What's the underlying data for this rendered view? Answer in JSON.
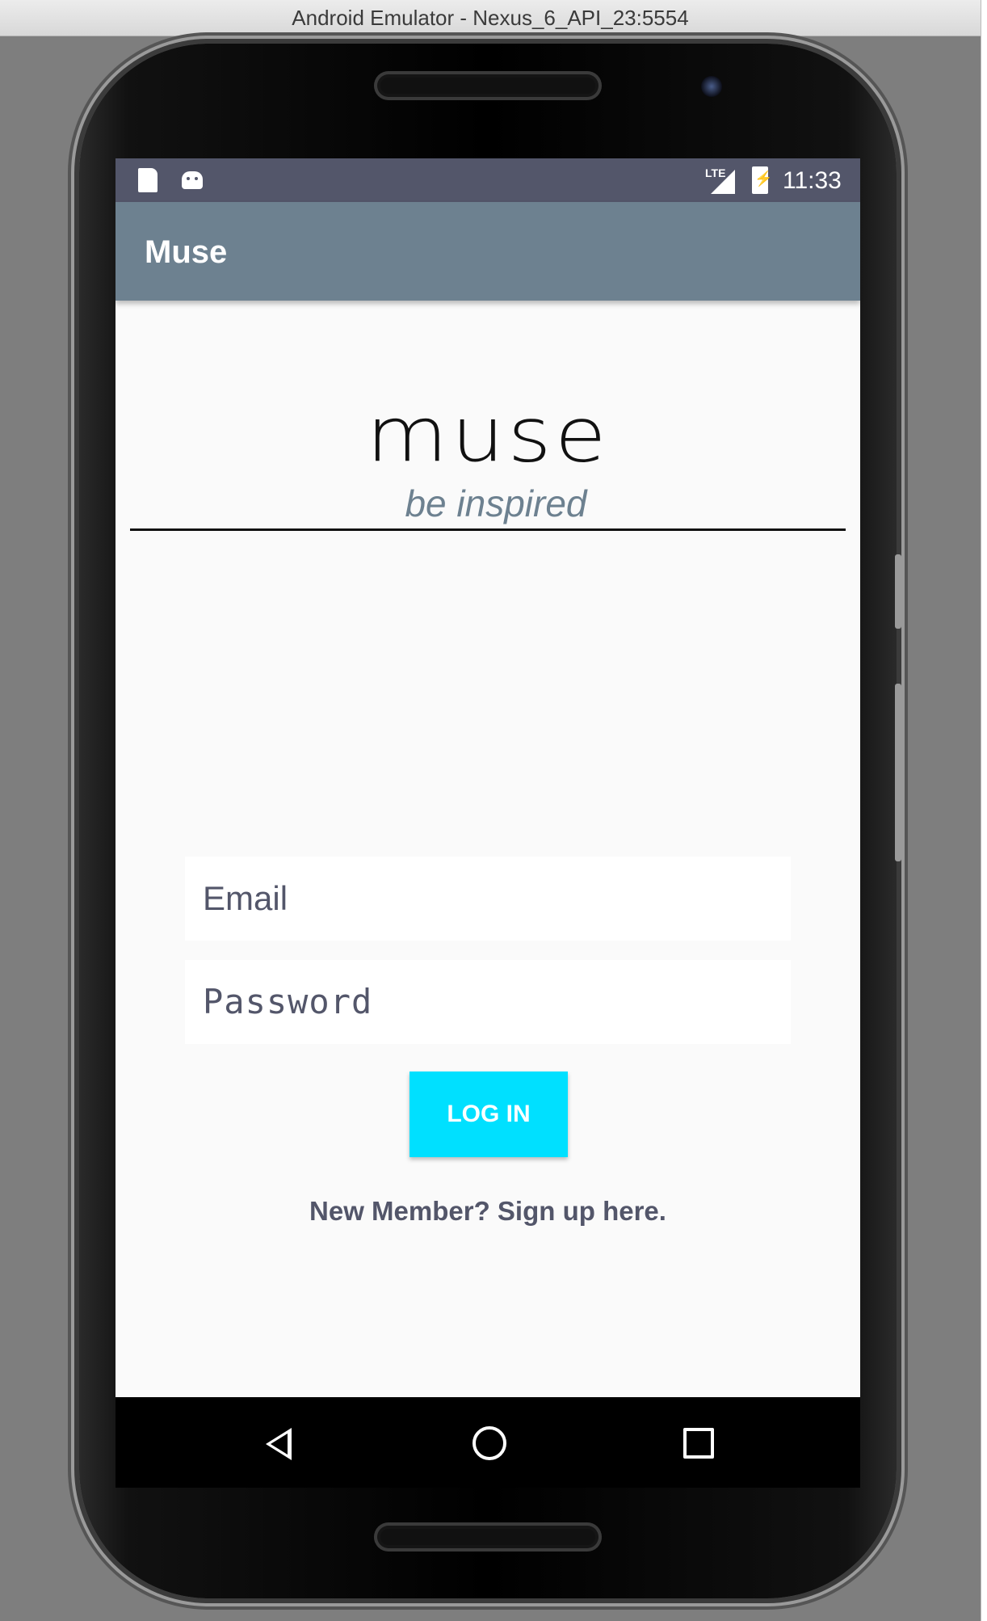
{
  "window": {
    "title": "Android Emulator - Nexus_6_API_23:5554"
  },
  "statusbar": {
    "network": "LTE",
    "time": "11:33"
  },
  "appbar": {
    "title": "Muse"
  },
  "brand": {
    "logo": "muse",
    "tagline": "be inspired"
  },
  "form": {
    "email_placeholder": "Email",
    "password_placeholder": "Password",
    "login_label": "LOG IN",
    "signup_text": "New Member? Sign up here."
  },
  "colors": {
    "statusbar": "#53566a",
    "appbar": "#6d8190",
    "accent": "#00e0ff",
    "text": "#53566a"
  },
  "icons": {
    "statusbar": [
      "sd-card-icon",
      "android-debug-icon",
      "lte-signal-icon",
      "battery-charging-icon"
    ],
    "navbar": [
      "back-icon",
      "home-icon",
      "recents-icon"
    ]
  }
}
